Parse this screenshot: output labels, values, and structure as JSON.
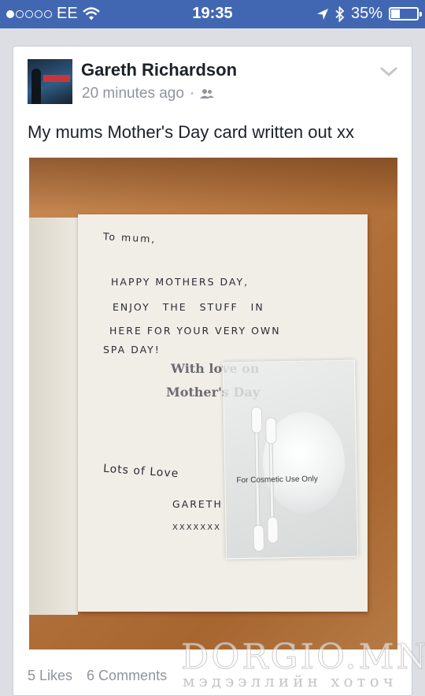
{
  "status_bar": {
    "signal_dots_filled": 1,
    "signal_dots_total": 5,
    "carrier": "EE",
    "time": "19:35",
    "battery_percent_label": "35%",
    "battery_level": 0.35,
    "icons": [
      "signal-dots-icon",
      "wifi-icon",
      "location-arrow-icon",
      "bluetooth-icon",
      "battery-icon"
    ]
  },
  "post": {
    "author": "Gareth Richardson",
    "timestamp": "20 minutes ago",
    "meta_separator": "·",
    "audience_icon": "friends-icon",
    "menu_icon": "chevron-down-icon",
    "text": "My mums Mother's Day card written out xx",
    "photo": {
      "handwriting": {
        "greeting": "To mum,",
        "line1": "HAPPY MOTHERS DAY,",
        "line2": "ENJOY THE STUFF IN",
        "line3": "HERE FOR YOUR VERY OWN",
        "line4": "SPA DAY!",
        "closing": "Lots of Love",
        "signature": "GARETH",
        "kisses": "XXXXXXX"
      },
      "printed_line1": "With love on",
      "printed_line2": "Mother's Day",
      "pouch_label": "For Cosmetic Use Only"
    },
    "likes": "5 Likes",
    "comments": "6 Comments"
  },
  "watermark": {
    "main": "DORGIO.MN",
    "sub": "мэдээллийн хоточ"
  },
  "colors": {
    "status_bar_bg": "#4267b2",
    "text_primary": "#1d2129",
    "text_secondary": "#90949c",
    "page_bg": "#dcdee3"
  }
}
